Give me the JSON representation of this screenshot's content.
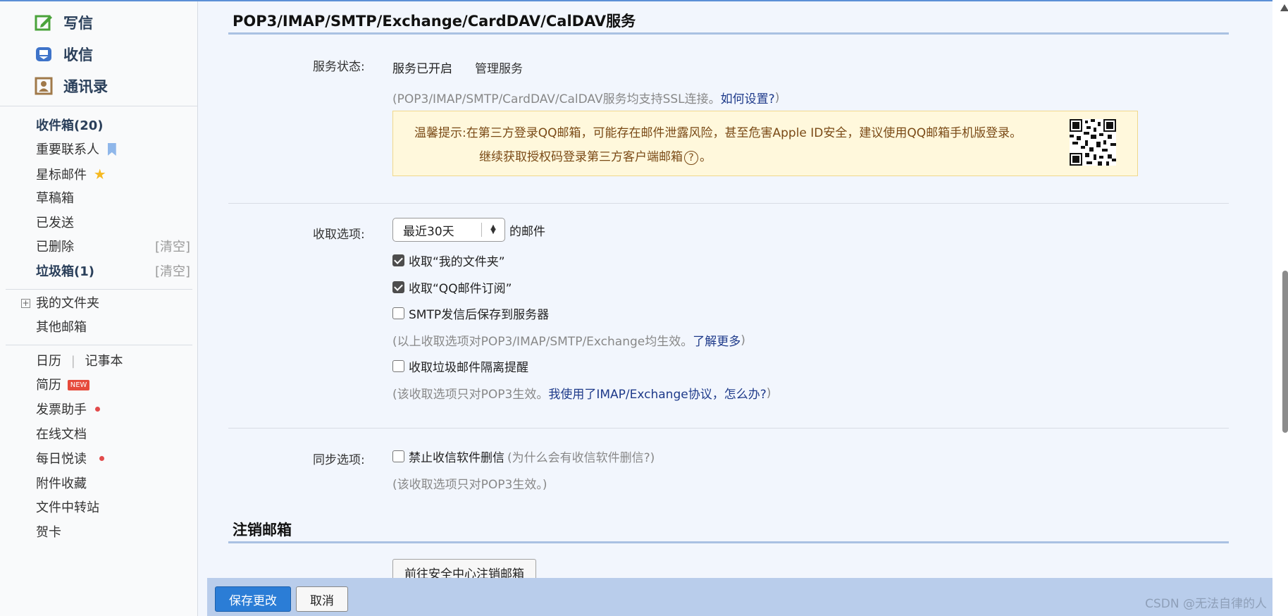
{
  "sidebar": {
    "compose": "写信",
    "inbox": "收信",
    "contacts": "通讯录",
    "folders": [
      {
        "label": "收件箱(20)",
        "bold": true
      },
      {
        "label": "重要联系人"
      },
      {
        "label": "星标邮件"
      },
      {
        "label": "草稿箱"
      },
      {
        "label": "已发送"
      },
      {
        "label": "已删除"
      },
      {
        "label": "垃圾箱(1)",
        "bold": true
      }
    ],
    "clear_label": "[清空]",
    "my_folders": "我的文件夹",
    "other_mailboxes": "其他邮箱",
    "tools": {
      "calendar": "日历",
      "divider": "|",
      "notepad": "记事本",
      "resume": "简历",
      "new_badge": "NEW",
      "invoice": "发票助手",
      "online_docs": "在线文档",
      "daily_reading": "每日悦读",
      "attachments": "附件收藏",
      "file_transfer": "文件中转站",
      "cards": "贺卡"
    }
  },
  "main": {
    "service_title": "POP3/IMAP/SMTP/Exchange/CardDAV/CalDAV服务",
    "service_status": {
      "label": "服务状态:",
      "value": "服务已开启",
      "manage": "管理服务",
      "ssl_note_prefix": "(POP3/IMAP/SMTP/CardDAV/CalDAV服务均支持SSL连接。",
      "ssl_note_link": "如何设置?",
      "ssl_note_suffix": ")"
    },
    "tip": {
      "line1": "温馨提示:在第三方登录QQ邮箱，可能存在邮件泄露风险，甚至危害Apple ID安全，建议使用QQ邮箱手机版登录。",
      "line2_prefix": "继续获取授权码登录第三方客户端邮箱",
      "line2_icon": "?",
      "line2_suffix": "。"
    },
    "receive": {
      "label": "收取选项:",
      "range_selected": "最近30天",
      "range_suffix": "的邮件",
      "opt_my_folders": "收取“我的文件夹”",
      "opt_my_folders_checked": true,
      "opt_subscriptions": "收取“QQ邮件订阅”",
      "opt_subscriptions_checked": true,
      "opt_smtp_save": "SMTP发信后保存到服务器",
      "opt_smtp_save_checked": false,
      "note1_prefix": "(以上收取选项对POP3/IMAP/SMTP/Exchange均生效。",
      "note1_link": "了解更多",
      "note1_suffix": ")",
      "opt_spam_alert": "收取垃圾邮件隔离提醒",
      "opt_spam_alert_checked": false,
      "note2_prefix": "(该收取选项只对POP3生效。",
      "note2_link": "我使用了IMAP/Exchange协议，怎么办?",
      "note2_suffix": ")"
    },
    "sync": {
      "label": "同步选项:",
      "opt_no_delete": "禁止收信软件删信",
      "opt_no_delete_checked": false,
      "why": "(为什么会有收信软件删信?)",
      "note": "(该收取选项只对POP3生效。)"
    },
    "cancel_title": "注销邮箱",
    "cancel_button": "前往安全中心注销邮箱"
  },
  "footer": {
    "save": "保存更改",
    "cancel": "取消",
    "watermark": "CSDN @无法自律的人"
  }
}
